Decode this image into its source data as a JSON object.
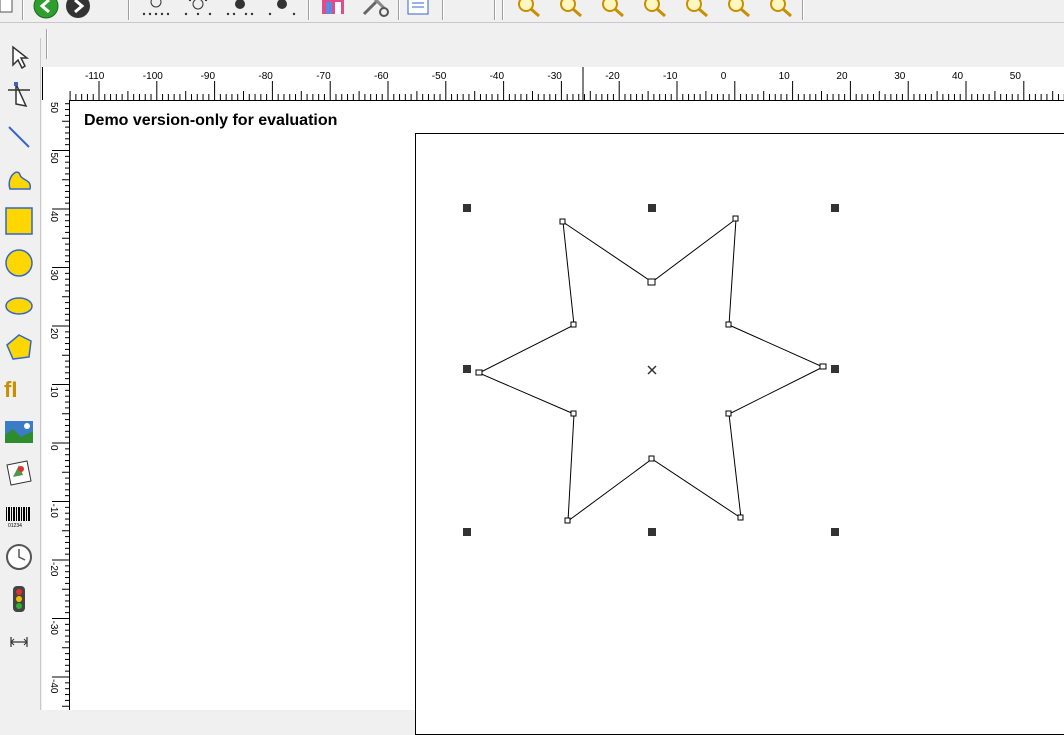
{
  "app": {
    "watermark": "Demo version-only for evaluation"
  },
  "toolbar": {
    "icons": [
      "page-icon",
      "back-icon",
      "forward-icon",
      "point-icon-1",
      "point-icon-2",
      "point-icon-3",
      "point-icon-4",
      "chart-icon",
      "tools-icon",
      "properties-icon",
      "zoom-icon-1",
      "zoom-icon-2",
      "zoom-icon-3",
      "zoom-icon-4",
      "zoom-icon-5",
      "zoom-icon-6",
      "zoom-icon-7"
    ]
  },
  "toolbox": {
    "tools": [
      "select-pointer",
      "node-edit",
      "line",
      "freeform",
      "rectangle",
      "circle",
      "ellipse",
      "polygon",
      "text",
      "image",
      "clip-art",
      "barcode",
      "clock",
      "traffic-light",
      "dimension"
    ],
    "text_tool_label": "fI",
    "barcode_digits": "01234"
  },
  "ruler_h": {
    "labels": [
      "-110",
      "-100",
      "-90",
      "-80",
      "-70",
      "-60",
      "-50",
      "-40",
      "-30",
      "-20",
      "-10",
      "0",
      "10",
      "20",
      "30",
      "40",
      "50"
    ]
  },
  "ruler_v": {
    "labels": [
      "50",
      "50",
      "40",
      "30",
      "20",
      "10",
      "0",
      "-10",
      "-20",
      "-30",
      "-40"
    ]
  },
  "colors": {
    "shape_fill": "#ffd700",
    "selection_handle": "#333333",
    "star_stroke": "#000000"
  }
}
